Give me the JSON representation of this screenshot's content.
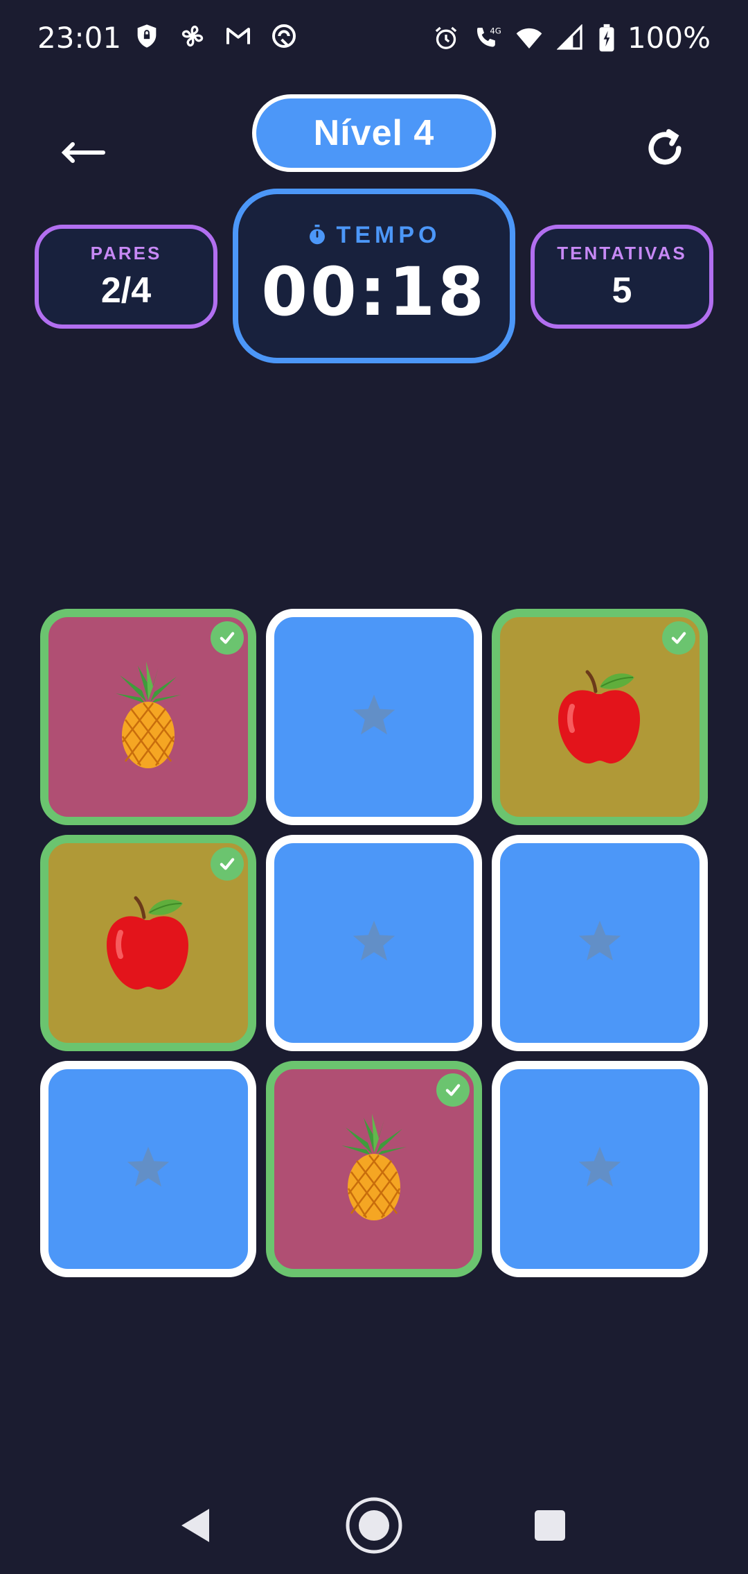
{
  "status_bar": {
    "time": "23:01",
    "left_icons": [
      "vpn-shield-icon",
      "fan-icon",
      "gmail-icon",
      "sync-icon"
    ],
    "right_icons": [
      "alarm-icon",
      "call-4g-icon",
      "wifi-icon",
      "signal-icon",
      "battery-charging-icon"
    ],
    "battery": "100%"
  },
  "header": {
    "level_label": "Nível 4",
    "back_icon": "arrow-left-icon",
    "refresh_icon": "refresh-icon"
  },
  "stats": {
    "pairs_label": "PARES",
    "pairs_value": "2/4",
    "time_label": "TEMPO",
    "time_value": "00:18",
    "attempts_label": "TENTATIVAS",
    "attempts_value": "5"
  },
  "board": {
    "cards": [
      {
        "state": "matched",
        "fruit": "pineapple"
      },
      {
        "state": "hidden",
        "fruit": ""
      },
      {
        "state": "matched",
        "fruit": "apple"
      },
      {
        "state": "matched",
        "fruit": "apple"
      },
      {
        "state": "hidden",
        "fruit": ""
      },
      {
        "state": "hidden",
        "fruit": ""
      },
      {
        "state": "hidden",
        "fruit": ""
      },
      {
        "state": "matched",
        "fruit": "pineapple"
      },
      {
        "state": "hidden",
        "fruit": ""
      }
    ]
  },
  "colors": {
    "background": "#1b1c30",
    "primary_blue": "#4c97f8",
    "purple": "#b26ff0",
    "match_green": "#6bc46f",
    "pineapple_card": "#b04f73",
    "apple_card": "#b09937"
  },
  "nav": {
    "icons": [
      "back-triangle-icon",
      "home-circle-icon",
      "recents-square-icon"
    ]
  }
}
